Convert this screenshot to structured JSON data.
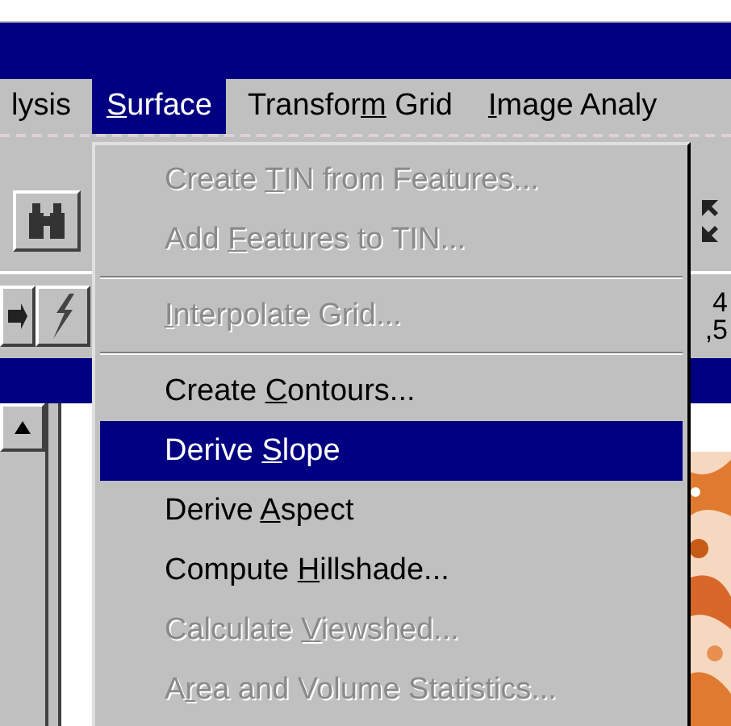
{
  "menu_bar": [
    {
      "label": {
        "post": "lysis"
      },
      "selected": false
    },
    {
      "label": {
        "key": "S",
        "post": "urface"
      },
      "selected": true
    },
    {
      "label": {
        "pre": "Transfor",
        "key": "m",
        "post": " Grid"
      },
      "selected": false
    },
    {
      "label": {
        "key": "I",
        "post": "mage Analy"
      },
      "selected": false
    }
  ],
  "menu": [
    {
      "kind": "item",
      "label": {
        "pre": "Create ",
        "key": "T",
        "post": "IN from Features..."
      },
      "disabled": true,
      "selected": false
    },
    {
      "kind": "item",
      "label": {
        "pre": "Add ",
        "key": "F",
        "post": "eatures to TIN..."
      },
      "disabled": true,
      "selected": false
    },
    {
      "kind": "separator"
    },
    {
      "kind": "item",
      "label": {
        "key": "I",
        "post": "nterpolate Grid..."
      },
      "disabled": true,
      "selected": false
    },
    {
      "kind": "separator"
    },
    {
      "kind": "item",
      "label": {
        "pre": "Create ",
        "key": "C",
        "post": "ontours..."
      },
      "disabled": false,
      "selected": false
    },
    {
      "kind": "item",
      "label": {
        "pre": "Derive ",
        "key": "S",
        "post": "lope"
      },
      "disabled": false,
      "selected": true
    },
    {
      "kind": "item",
      "label": {
        "pre": "Derive ",
        "key": "A",
        "post": "spect"
      },
      "disabled": false,
      "selected": false
    },
    {
      "kind": "item",
      "label": {
        "pre": "Compute ",
        "key": "H",
        "post": "illshade..."
      },
      "disabled": false,
      "selected": false
    },
    {
      "kind": "item",
      "label": {
        "pre": "Calculate ",
        "key": "V",
        "post": "iewshed..."
      },
      "disabled": true,
      "selected": false
    },
    {
      "kind": "item",
      "label": {
        "pre": "A",
        "key": "r",
        "post": "ea and Volume Statistics..."
      },
      "disabled": true,
      "selected": false
    }
  ],
  "toolbar_readout": [
    "4",
    ",5"
  ]
}
